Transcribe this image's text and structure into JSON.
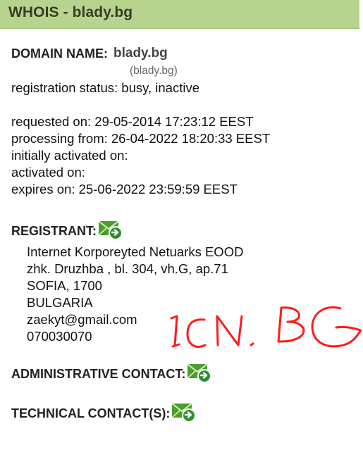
{
  "header": {
    "title": "WHOIS - blady.bg"
  },
  "domain": {
    "label": "DOMAIN NAME:",
    "value": "blady.bg",
    "subvalue": "(blady.bg)"
  },
  "registration": {
    "status": "registration status: busy, inactive"
  },
  "dates": {
    "requested": "requested on: 29-05-2014 17:23:12 EEST",
    "processing": "processing from: 26-04-2022 18:20:33 EEST",
    "initially_activated": "initially activated on:",
    "activated": "activated on:",
    "expires": "expires on: 25-06-2022 23:59:59 EEST"
  },
  "registrant": {
    "label": "REGISTRANT:",
    "name": "Internet Korporeyted Netuarks EOOD",
    "address": "zhk. Druzhba , bl. 304, vh.G, ap.71",
    "city": "SOFIA, 1700",
    "country": "BULGARIA",
    "email": "zaekyt@gmail.com",
    "phone": "070030070"
  },
  "admin_contact": {
    "label": "ADMINISTRATIVE CONTACT:"
  },
  "technical_contact": {
    "label": "TECHNICAL CONTACT(S):"
  },
  "annotation": {
    "text": "ICN.BG",
    "color": "#ff1a1a"
  },
  "icons": {
    "contact_mail": "mail-forward-icon"
  },
  "colors": {
    "header_bg": "#b7d48f",
    "header_text": "#3b3b24",
    "mail_green": "#4c9d2c"
  }
}
